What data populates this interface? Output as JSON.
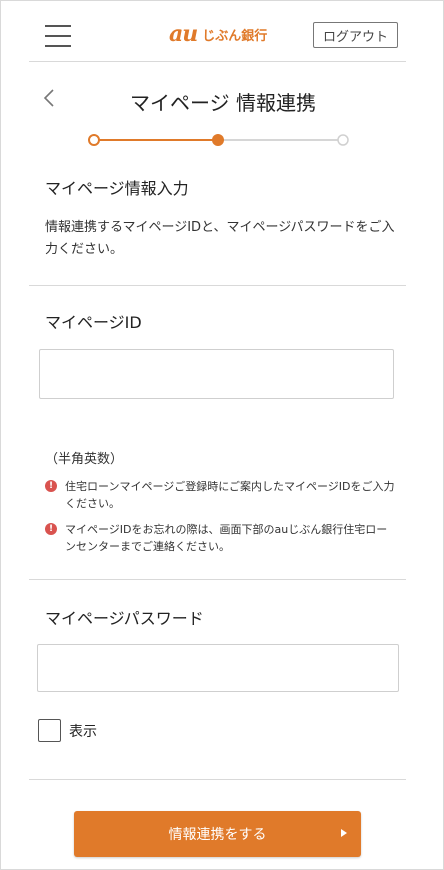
{
  "header": {
    "logo_au": "au",
    "logo_bank": "じぶん銀行",
    "logout_label": "ログアウト"
  },
  "page": {
    "title": "マイページ 情報連携",
    "steps": {
      "total": 3,
      "current": 2
    }
  },
  "section_intro": {
    "heading": "マイページ情報入力",
    "description": "情報連携するマイページIDと、マイページパスワードをご入力ください。"
  },
  "mypage_id": {
    "label": "マイページID",
    "value": "",
    "placeholder": "",
    "hint": "（半角英数）",
    "notices": [
      "住宅ローンマイページご登録時にご案内したマイページIDをご入力ください。",
      "マイページIDをお忘れの際は、画面下部のauじぶん銀行住宅ローンセンターまでご連絡ください。"
    ]
  },
  "password": {
    "label": "マイページパスワード",
    "value": "",
    "placeholder": "",
    "show_label": "表示",
    "show_checked": false
  },
  "submit": {
    "label": "情報連携をする"
  },
  "colors": {
    "accent": "#e07a2a",
    "alert": "#d9534f",
    "divider": "#d9d9d9"
  }
}
